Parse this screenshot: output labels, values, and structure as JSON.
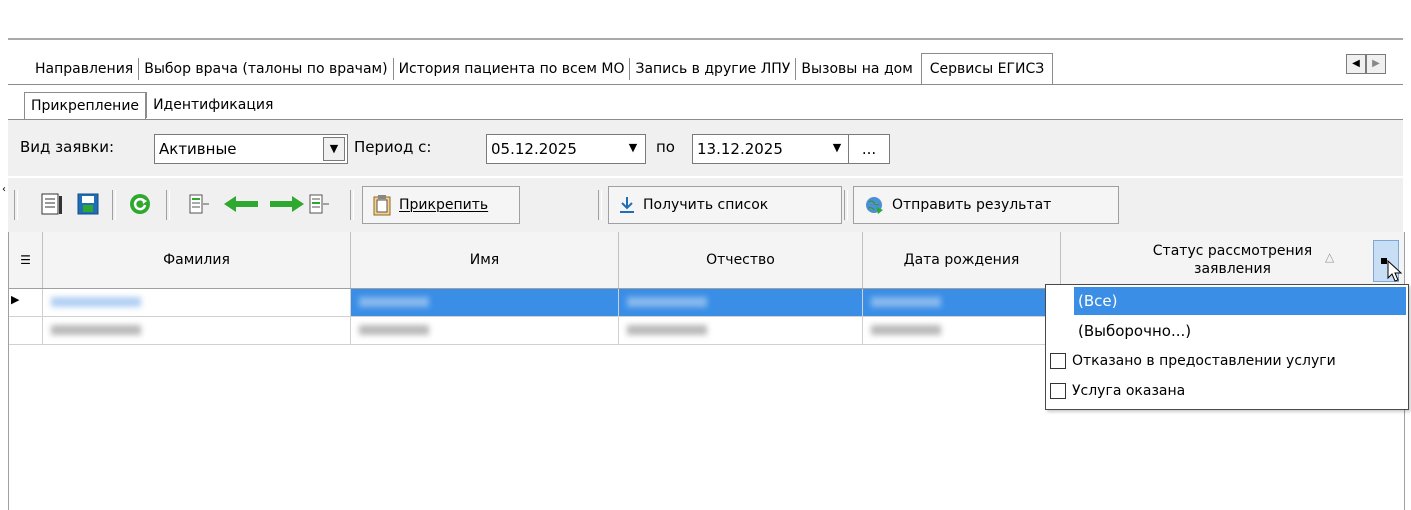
{
  "top_tabs": [
    "Направления",
    "Выбор врача (талоны по врачам)",
    "История пациента по всем МО",
    "Запись в другие ЛПУ",
    "Вызовы на дом",
    "Сервисы ЕГИСЗ"
  ],
  "scroll_buttons": {
    "left": "◀",
    "right": "▶"
  },
  "sub_tabs": [
    "Прикрепление",
    "Идентификация"
  ],
  "filter": {
    "request_type_label": "Вид заявки:",
    "request_type_value": "Активные",
    "period_from_label": "Период с:",
    "period_from_value": "05.12.2025",
    "period_to_label": "по",
    "period_to_value": "13.12.2025",
    "ellipsis": "..."
  },
  "toolbar": {
    "attach_label": "Прикрепить",
    "get_list_label": "Получить список",
    "send_result_label": "Отправить результат"
  },
  "grid": {
    "columns": [
      "Фамилия",
      "Имя",
      "Отчество",
      "Дата рождения",
      "Статус рассмотрения заявления"
    ],
    "row_marker": "▶"
  },
  "status_filter": {
    "options": [
      "(Все)",
      "(Выборочно...)",
      "Отказано в предоставлении услуги",
      "Услуга оказана"
    ],
    "selected": "(Все)"
  },
  "colors": {
    "selection": "#3a8ee6",
    "panel": "#f0f0f0",
    "green_arrow": "#2ea82e"
  }
}
